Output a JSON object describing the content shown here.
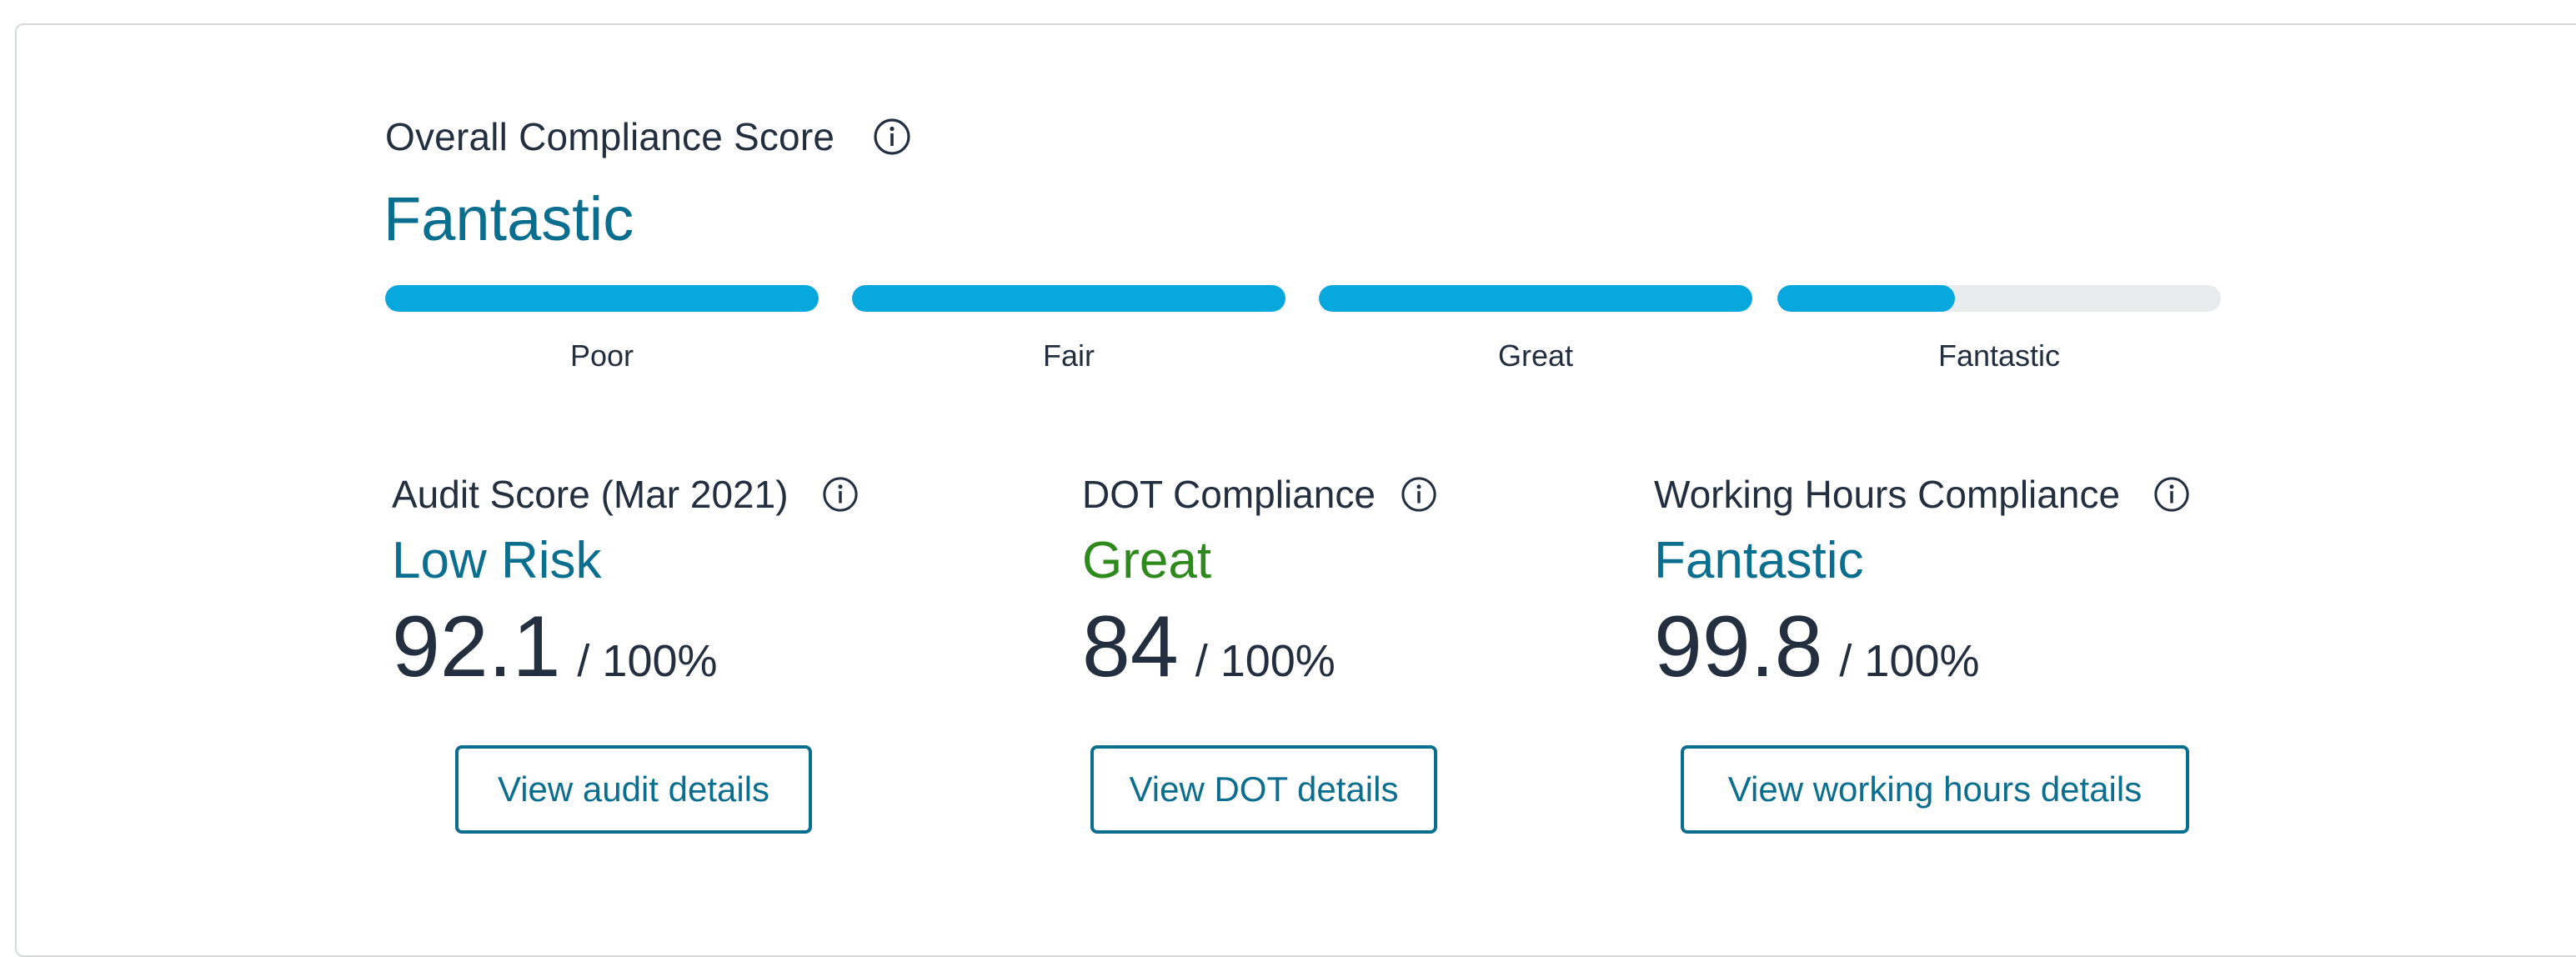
{
  "overall": {
    "title": "Overall Compliance Score",
    "rating": "Fantastic",
    "rating_color": "#0a6e8f",
    "bar_color": "#06a8de",
    "track_color": "#e9ebed",
    "levels": [
      {
        "label": "Poor",
        "fill_fraction": 1.0
      },
      {
        "label": "Fair",
        "fill_fraction": 1.0
      },
      {
        "label": "Great",
        "fill_fraction": 1.0
      },
      {
        "label": "Fantastic",
        "fill_fraction": 0.4
      }
    ]
  },
  "metrics": [
    {
      "title": "Audit Score (Mar 2021)",
      "rating": "Low Risk",
      "rating_color": "#0a6e8f",
      "value": "92.1",
      "suffix": "/ 100%",
      "button_label": "View audit details"
    },
    {
      "title": "DOT Compliance",
      "rating": "Great",
      "rating_color": "#2f8a1e",
      "value": "84",
      "suffix": "/ 100%",
      "button_label": "View DOT details"
    },
    {
      "title": "Working Hours Compliance",
      "rating": "Fantastic",
      "rating_color": "#0a6e8f",
      "value": "99.8",
      "suffix": "/ 100%",
      "button_label": "View working hours details"
    }
  ],
  "icons": {
    "info": "info-circle-icon"
  }
}
